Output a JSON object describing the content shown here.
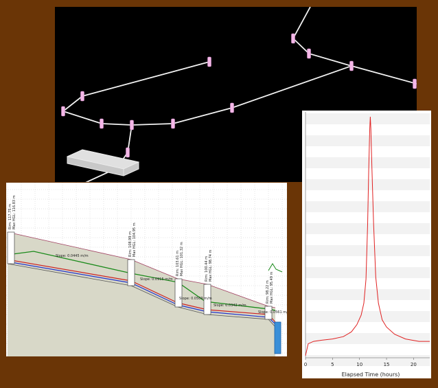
{
  "colors": {
    "background": "#6a3506",
    "network_bg": "#000000",
    "pipe": "#f2f2f2",
    "node": "#f5b8e8",
    "ground_fill": "#d8d8c8",
    "hgl": "#1a8a1a",
    "crown": "#cc2222",
    "invert": "#2233cc",
    "water": "#3a8fd8",
    "hydrograph_line": "#e02020"
  },
  "profile": {
    "nodes": [
      {
        "rim": "Rim: 117.75 m",
        "hgl": "Max HGL: 116.83 m"
      },
      {
        "rim": "Rim: 108.99 m",
        "hgl": "Max HGL: 104.95 m"
      },
      {
        "rim": "Rim: 103.61 m",
        "hgl": "Max HGL: 101.32 m"
      },
      {
        "rim": "Rim: 100.44 m",
        "hgl": "Max HGL: 98.74 m"
      },
      {
        "rim": "Rim: 98.22 m",
        "hgl": "Max HGL: 95.49 m"
      }
    ],
    "slopes": [
      "Slope: 0.0445 m/m",
      "Slope: 0.0915 m/m",
      "Slope: 0.0509 m/m",
      "Slope: 0.0342 m/m",
      "Slope: 0.0561 m/m"
    ]
  },
  "chart_data": {
    "type": "line",
    "xlabel": "Elapsed Time (hours)",
    "x_ticks": [
      "0",
      "5",
      "10",
      "15",
      "20"
    ],
    "xlim": [
      0,
      23
    ],
    "x": [
      0,
      0.5,
      1.5,
      3,
      5,
      7,
      8.5,
      9.5,
      10.3,
      10.8,
      11.2,
      11.5,
      11.7,
      11.9,
      12.0,
      12.1,
      12.3,
      12.6,
      13.0,
      13.5,
      14.2,
      15.0,
      16.5,
      18.5,
      21,
      23
    ],
    "y": [
      0,
      0.05,
      0.06,
      0.065,
      0.07,
      0.08,
      0.1,
      0.13,
      0.17,
      0.22,
      0.32,
      0.55,
      0.78,
      0.95,
      1.0,
      0.95,
      0.78,
      0.55,
      0.33,
      0.22,
      0.15,
      0.12,
      0.09,
      0.07,
      0.06,
      0.06
    ],
    "ylim": [
      0,
      1
    ]
  }
}
